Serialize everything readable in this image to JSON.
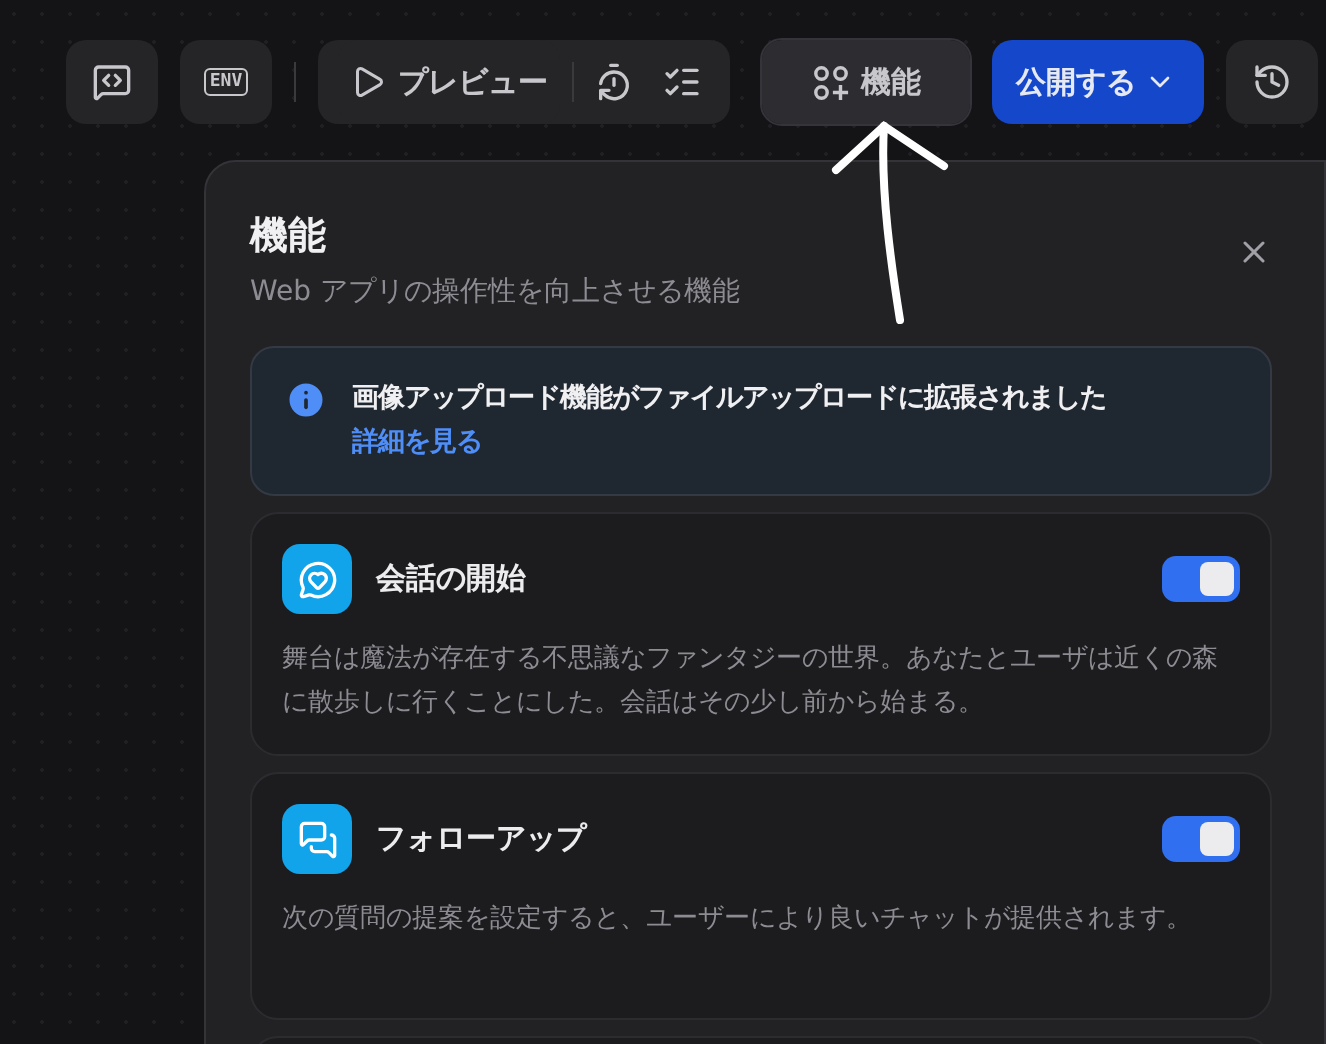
{
  "toolbar": {
    "env_label": "ENV",
    "preview": "プレビュー",
    "features": {
      "label": "機能",
      "selected": true
    },
    "publish": "公開する"
  },
  "panel": {
    "title": "機能",
    "subtitle": "Web アプリの操作性を向上させる機能",
    "notice": {
      "text": "画像アップロード機能がファイルアップロードに拡張されました",
      "link": "詳細を見る"
    },
    "features": [
      {
        "kind": "opener",
        "name": "会話の開始",
        "description": "舞台は魔法が存在する不思議なファンタジーの世界。あなたとユーザは近くの森に散歩しに行くことにした。会話はその少し前から始まる。",
        "on": true
      },
      {
        "kind": "followup",
        "name": "フォローアップ",
        "description": "次の質問の提案を設定すると、ユーザーにより良いチャットが提供されます。",
        "on": true
      }
    ]
  }
}
